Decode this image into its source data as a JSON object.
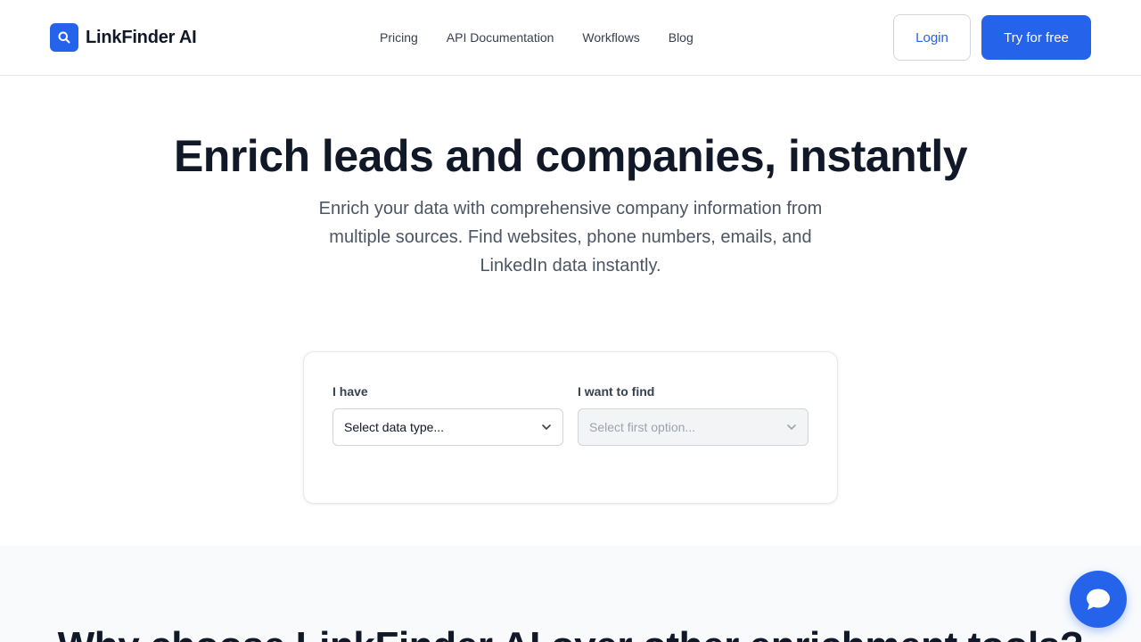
{
  "brand": {
    "name": "LinkFinder AI",
    "accent_color": "#2563eb",
    "logo_icon": "search-icon"
  },
  "nav": {
    "items": [
      {
        "label": "Pricing"
      },
      {
        "label": "API Documentation"
      },
      {
        "label": "Workflows"
      },
      {
        "label": "Blog"
      }
    ]
  },
  "header_actions": {
    "login_label": "Login",
    "try_label": "Try for free"
  },
  "hero": {
    "title": "Enrich leads and companies, instantly",
    "subtitle": "Enrich your data with comprehensive company information from multiple sources. Find websites, phone numbers, emails, and LinkedIn data instantly."
  },
  "form": {
    "have_label": "I have",
    "have_value": "Select data type...",
    "find_label": "I want to find",
    "find_value": "Select first option..."
  },
  "section": {
    "title": "Why choose LinkFinder AI over other enrichment tools?"
  },
  "chat": {
    "icon": "chat-bubble-icon"
  }
}
